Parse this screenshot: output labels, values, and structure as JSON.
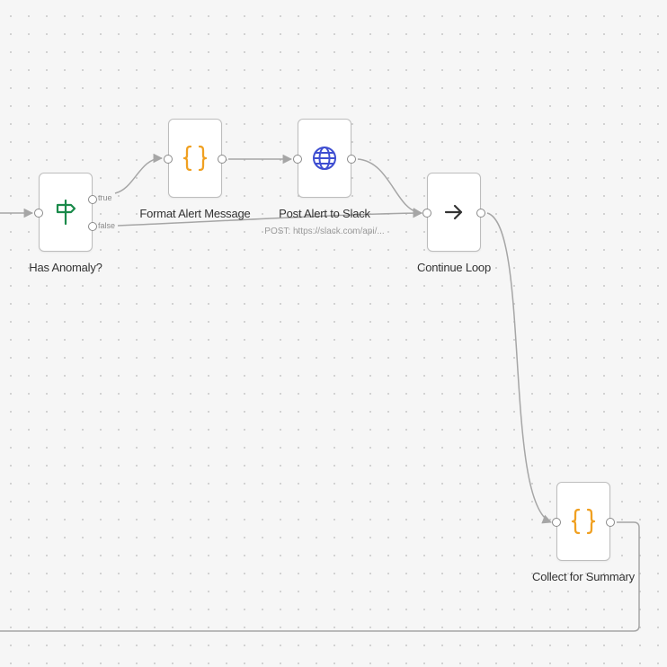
{
  "colors": {
    "canvas": "#f6f6f6",
    "edge": "#a6a6a6",
    "if_icon": "#1a8a4a",
    "set_icon": "#f0a021",
    "http_icon": "#3f4fd1",
    "noop_icon": "#333333"
  },
  "nodes": {
    "has_anomaly": {
      "label": "Has Anomaly?",
      "icon": "signpost-icon",
      "branches": {
        "true": "true",
        "false": "false"
      }
    },
    "format_alert": {
      "label": "Format Alert Message",
      "icon": "curly-braces-icon"
    },
    "post_alert": {
      "label": "Post Alert to Slack",
      "subtitle": "POST: https://slack.com/api/...",
      "icon": "globe-icon"
    },
    "continue_loop": {
      "label": "Continue Loop",
      "icon": "arrow-right-icon"
    },
    "collect_summary": {
      "label": "Collect for Summary",
      "icon": "curly-braces-icon"
    }
  }
}
